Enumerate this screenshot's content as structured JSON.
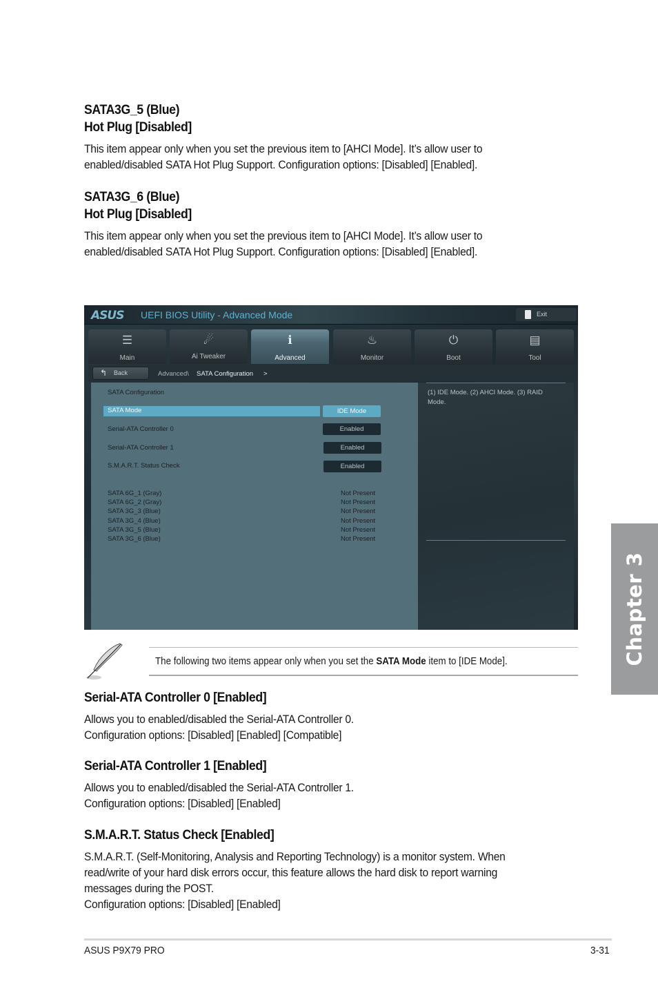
{
  "sections_top": [
    {
      "title_line1": "SATA3G_5 (Blue)",
      "title_line2": "Hot Plug [Disabled]",
      "body_line1": "This item appear only when you set the previous item to [AHCI Mode]. It’s allow user to",
      "body_line2": "enabled/disabled SATA Hot Plug Support. Configuration options: [Disabled] [Enabled]."
    },
    {
      "title_line1": "SATA3G_6 (Blue)",
      "title_line2": "Hot Plug [Disabled]",
      "body_line1": "This item appear only when you set the previous item to [AHCI Mode]. It’s allow user to",
      "body_line2": "enabled/disabled SATA Hot Plug Support. Configuration options: [Disabled] [Enabled]."
    }
  ],
  "bios": {
    "logo": "ASUS",
    "title": "UEFI BIOS Utility - Advanced Mode",
    "exit_label": "Exit",
    "tabs": [
      {
        "label": "Main",
        "icon": "list-icon",
        "glyph": "☰"
      },
      {
        "label": "Ai  Tweaker",
        "icon": "tweaker-icon",
        "glyph": "☄"
      },
      {
        "label": "Advanced",
        "icon": "advanced-info-icon",
        "glyph": "ℹ",
        "active": true
      },
      {
        "label": "Monitor",
        "icon": "monitor-thermometer-icon",
        "glyph": "♨"
      },
      {
        "label": "Boot",
        "icon": "power-icon",
        "glyph": "⏻"
      },
      {
        "label": "Tool",
        "icon": "toolbox-icon",
        "glyph": "▤"
      }
    ],
    "back_label": "Back",
    "breadcrumb_parent": "Advanced\\",
    "breadcrumb_current": "SATA Configuration",
    "breadcrumb_sep": ">",
    "section_title": "SATA Configuration",
    "settings": [
      {
        "label": "SATA Mode",
        "value": "IDE Mode",
        "selected": true
      },
      {
        "label": "Serial-ATA Controller 0",
        "value": "Enabled"
      },
      {
        "label": "Serial-ATA Controller 1",
        "value": "Enabled"
      },
      {
        "label": "S.M.A.R.T. Status Check",
        "value": "Enabled"
      }
    ],
    "ports": [
      {
        "name": "SATA 6G_1 (Gray)",
        "status": "Not Present"
      },
      {
        "name": "SATA 6G_2 (Gray)",
        "status": "Not Present"
      },
      {
        "name": "SATA 3G_3 (Blue)",
        "status": "Not Present"
      },
      {
        "name": "SATA 3G_4 (Blue)",
        "status": "Not Present"
      },
      {
        "name": "SATA 3G_5 (Blue)",
        "status": "Not Present"
      },
      {
        "name": "SATA 3G_6 (Blue)",
        "status": "Not Present"
      }
    ],
    "help_text": "(1) IDE Mode. (2) AHCI Mode. (3) RAID Mode."
  },
  "note": {
    "icon": "feather-pen-icon",
    "text_before": "The following two items appear only when you set the ",
    "text_bold": "SATA Mode",
    "text_after": " item to [IDE Mode]."
  },
  "sections_bottom": [
    {
      "title": "Serial-ATA Controller 0 [Enabled]",
      "lines": [
        "Allows you to enabled/disabled the Serial-ATA Controller 0.",
        "Configuration options: [Disabled] [Enabled] [Compatible]"
      ]
    },
    {
      "title": "Serial-ATA Controller 1 [Enabled]",
      "lines": [
        "Allows you to enabled/disabled the Serial-ATA Controller 1.",
        "Configuration options: [Disabled] [Enabled]"
      ]
    },
    {
      "title": "S.M.A.R.T. Status Check [Enabled]",
      "lines": [
        "S.M.A.R.T. (Self-Monitoring, Analysis and Reporting Technology) is a monitor system. When",
        "read/write of your hard disk errors occur, this feature allows the hard disk to report warning",
        "messages during the POST.",
        "Configuration options: [Disabled] [Enabled]"
      ]
    }
  ],
  "chapter_tab": "Chapter 3",
  "footer": {
    "product": "ASUS P9X79 PRO",
    "page": "3-31"
  }
}
